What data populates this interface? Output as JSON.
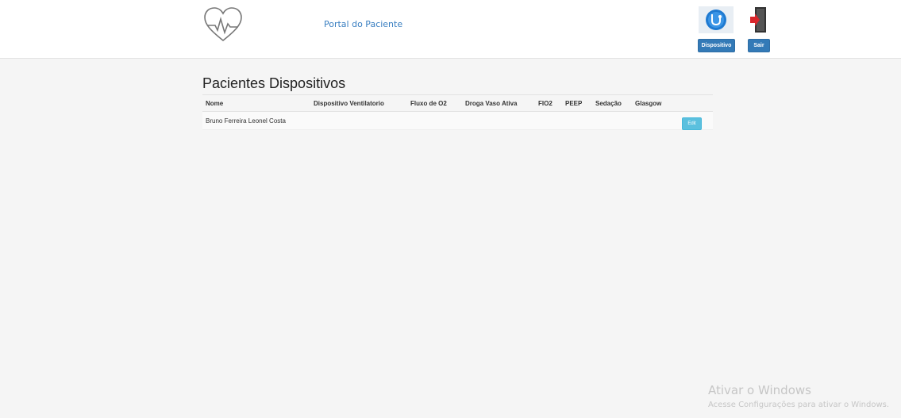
{
  "header": {
    "portal_title": "Portal do Paciente",
    "device_button_label": "Dispositivo",
    "exit_button_label": "Sair",
    "icons": {
      "logo": "heart-pulse-icon",
      "device": "stethoscope-icon",
      "exit": "exit-door-icon"
    },
    "accent_color": "#337ab7"
  },
  "main": {
    "title": "Pacientes Dispositivos",
    "columns": [
      "Nome",
      "Dispositivo Ventilatorio",
      "Fluxo de O2",
      "Droga Vaso Ativa",
      "FIO2",
      "PEEP",
      "Sedação",
      "Glasgow"
    ],
    "rows": [
      {
        "nome": "Bruno Ferreira Leonel Costa",
        "dispositivo": "",
        "fluxo": "",
        "droga": "",
        "fio2": "",
        "peep": "",
        "sedacao": "",
        "glasgow": "",
        "edit_label": "Edit"
      }
    ]
  },
  "watermark": {
    "line1": "Ativar o Windows",
    "line2": "Acesse Configurações para ativar o Windows."
  }
}
